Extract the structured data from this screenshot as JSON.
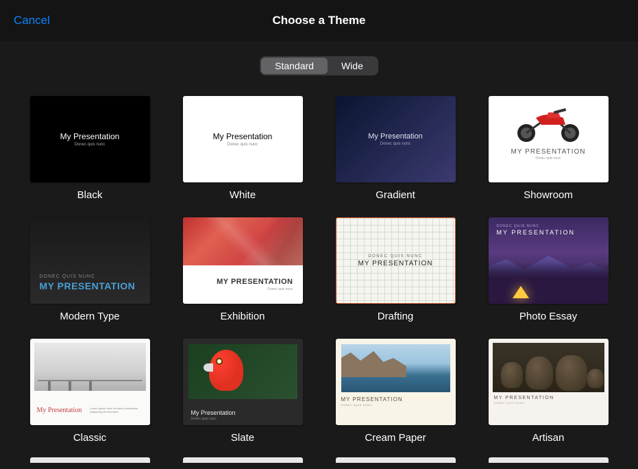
{
  "header": {
    "cancel": "Cancel",
    "title": "Choose a Theme"
  },
  "segments": {
    "standard": "Standard",
    "wide": "Wide",
    "active": "standard"
  },
  "sample": {
    "title": "My Presentation",
    "title_caps": "MY PRESENTATION",
    "sub": "Donec quis nunc",
    "sub_caps": "DONEC QUIS NUNC",
    "lorem": "Lorem ipsum dolor sit amet consectetur adipiscing elit sed diam"
  },
  "themes": [
    {
      "id": "black",
      "label": "Black"
    },
    {
      "id": "white",
      "label": "White"
    },
    {
      "id": "gradient",
      "label": "Gradient"
    },
    {
      "id": "showroom",
      "label": "Showroom"
    },
    {
      "id": "modern",
      "label": "Modern Type"
    },
    {
      "id": "exhibition",
      "label": "Exhibition"
    },
    {
      "id": "drafting",
      "label": "Drafting"
    },
    {
      "id": "photo",
      "label": "Photo Essay"
    },
    {
      "id": "classic",
      "label": "Classic"
    },
    {
      "id": "slate",
      "label": "Slate"
    },
    {
      "id": "cream",
      "label": "Cream Paper"
    },
    {
      "id": "artisan",
      "label": "Artisan"
    }
  ]
}
